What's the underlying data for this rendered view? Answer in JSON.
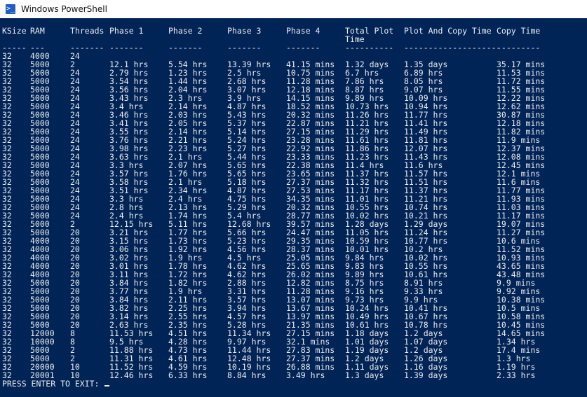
{
  "window": {
    "title": "Windows PowerShell",
    "icon": "powershell-icon"
  },
  "table": {
    "headers": [
      "KSize",
      "RAM",
      "Threads",
      "Phase 1",
      "Phase 2",
      "Phase 3",
      "Phase 4",
      "Total Plot",
      "Plot And Copy Time",
      "Copy Time"
    ],
    "header_line2": "Time",
    "separators": [
      "-----",
      "---",
      "-------",
      "-------",
      "-------",
      "-------",
      "-------",
      "----------",
      "--------------------",
      "---------"
    ],
    "rows": [
      [
        "32",
        "4000",
        "24",
        "",
        "",
        "",
        "",
        "",
        "",
        ""
      ],
      [
        "32",
        "5000",
        "2",
        "12.1 hrs",
        "5.54 hrs",
        "13.39 hrs",
        "41.15 mins",
        "1.32 days",
        "1.35 days",
        "35.17 mins"
      ],
      [
        "32",
        "5000",
        "24",
        "2.79 hrs",
        "1.23 hrs",
        "2.5 hrs",
        "10.75 mins",
        "6.7 hrs",
        "6.89 hrs",
        "11.53 mins"
      ],
      [
        "32",
        "5000",
        "24",
        "3.54 hrs",
        "1.44 hrs",
        "2.68 hrs",
        "11.28 mins",
        "7.86 hrs",
        "8.05 hrs",
        "11.72 mins"
      ],
      [
        "32",
        "5000",
        "24",
        "3.56 hrs",
        "2.04 hrs",
        "3.07 hrs",
        "12.18 mins",
        "8.87 hrs",
        "9.07 hrs",
        "11.55 mins"
      ],
      [
        "32",
        "5000",
        "24",
        "3.43 hrs",
        "2.3 hrs",
        "3.9 hrs",
        "14.15 mins",
        "9.89 hrs",
        "10.09 hrs",
        "12.22 mins"
      ],
      [
        "32",
        "5000",
        "24",
        "3.4 hrs",
        "2.14 hrs",
        "4.87 hrs",
        "18.52 mins",
        "10.73 hrs",
        "10.94 hrs",
        "12.62 mins"
      ],
      [
        "32",
        "5000",
        "24",
        "3.46 hrs",
        "2.03 hrs",
        "5.43 hrs",
        "20.32 mins",
        "11.26 hrs",
        "11.77 hrs",
        "30.87 mins"
      ],
      [
        "32",
        "5000",
        "24",
        "3.41 hrs",
        "2.05 hrs",
        "5.37 hrs",
        "22.87 mins",
        "11.21 hrs",
        "11.41 hrs",
        "12.18 mins"
      ],
      [
        "32",
        "5000",
        "24",
        "3.55 hrs",
        "2.14 hrs",
        "5.14 hrs",
        "27.15 mins",
        "11.29 hrs",
        "11.49 hrs",
        "11.82 mins"
      ],
      [
        "32",
        "5000",
        "24",
        "3.76 hrs",
        "2.21 hrs",
        "5.24 hrs",
        "23.28 mins",
        "11.61 hrs",
        "11.81 hrs",
        "11.9 mins"
      ],
      [
        "32",
        "5000",
        "24",
        "3.98 hrs",
        "2.23 hrs",
        "5.27 hrs",
        "22.92 mins",
        "11.86 hrs",
        "12.07 hrs",
        "12.37 mins"
      ],
      [
        "32",
        "5000",
        "24",
        "3.63 hrs",
        "2.1 hrs",
        "5.44 hrs",
        "23.33 mins",
        "11.23 hrs",
        "11.43 hrs",
        "12.08 mins"
      ],
      [
        "32",
        "5000",
        "24",
        "3.3 hrs",
        "2.07 hrs",
        "5.65 hrs",
        "22.38 mins",
        "11.4 hrs",
        "11.6 hrs",
        "12.45 mins"
      ],
      [
        "32",
        "5000",
        "24",
        "3.57 hrs",
        "1.76 hrs",
        "5.65 hrs",
        "23.65 mins",
        "11.37 hrs",
        "11.57 hrs",
        "12.1 mins"
      ],
      [
        "32",
        "5000",
        "24",
        "3.58 hrs",
        "2.1 hrs",
        "5.18 hrs",
        "27.37 mins",
        "11.32 hrs",
        "11.51 hrs",
        "11.6 mins"
      ],
      [
        "32",
        "5000",
        "24",
        "3.51 hrs",
        "2.34 hrs",
        "4.87 hrs",
        "27.53 mins",
        "11.17 hrs",
        "11.37 hrs",
        "11.77 mins"
      ],
      [
        "32",
        "5000",
        "24",
        "3.3 hrs",
        "2.4 hrs",
        "4.75 hrs",
        "34.35 mins",
        "11.01 hrs",
        "11.21 hrs",
        "11.93 mins"
      ],
      [
        "32",
        "5000",
        "24",
        "2.8 hrs",
        "2.13 hrs",
        "5.29 hrs",
        "20.32 mins",
        "10.55 hrs",
        "10.74 hrs",
        "11.03 mins"
      ],
      [
        "32",
        "5000",
        "24",
        "2.4 hrs",
        "1.74 hrs",
        "5.4 hrs",
        "28.77 mins",
        "10.02 hrs",
        "10.21 hrs",
        "11.17 mins"
      ],
      [
        "32",
        "5000",
        "2",
        "12.15 hrs",
        "5.11 hrs",
        "12.68 hrs",
        "39.57 mins",
        "1.28 days",
        "1.29 days",
        "19.07 mins"
      ],
      [
        "32",
        "5000",
        "20",
        "3.21 hrs",
        "1.77 hrs",
        "5.66 hrs",
        "24.47 mins",
        "11.05 hrs",
        "11.24 hrs",
        "11.27 mins"
      ],
      [
        "32",
        "4000",
        "20",
        "3.15 hrs",
        "1.73 hrs",
        "5.23 hrs",
        "29.35 mins",
        "10.59 hrs",
        "10.77 hrs",
        "10.6 mins"
      ],
      [
        "32",
        "4000",
        "20",
        "3.06 hrs",
        "1.92 hrs",
        "4.56 hrs",
        "28.37 mins",
        "10.01 hrs",
        "10.2 hrs",
        "11.52 mins"
      ],
      [
        "32",
        "4000",
        "20",
        "3.02 hrs",
        "1.9 hrs",
        "4.5 hrs",
        "25.05 mins",
        "9.84 hrs",
        "10.02 hrs",
        "10.93 mins"
      ],
      [
        "32",
        "4000",
        "20",
        "3.01 hrs",
        "1.78 hrs",
        "4.62 hrs",
        "25.65 mins",
        "9.83 hrs",
        "10.55 hrs",
        "43.65 mins"
      ],
      [
        "32",
        "4000",
        "20",
        "3.11 hrs",
        "1.72 hrs",
        "4.62 hrs",
        "26.02 mins",
        "9.89 hrs",
        "10.61 hrs",
        "43.48 mins"
      ],
      [
        "32",
        "5000",
        "20",
        "3.84 hrs",
        "1.82 hrs",
        "2.88 hrs",
        "12.82 mins",
        "8.75 hrs",
        "8.91 hrs",
        "9.9 mins"
      ],
      [
        "32",
        "5000",
        "20",
        "3.77 hrs",
        "1.9 hrs",
        "3.31 hrs",
        "11.28 mins",
        "9.16 hrs",
        "9.33 hrs",
        "9.92 mins"
      ],
      [
        "32",
        "5000",
        "20",
        "3.84 hrs",
        "2.11 hrs",
        "3.57 hrs",
        "13.07 mins",
        "9.73 hrs",
        "9.9 hrs",
        "10.38 mins"
      ],
      [
        "32",
        "5000",
        "20",
        "3.82 hrs",
        "2.25 hrs",
        "3.94 hrs",
        "13.67 mins",
        "10.24 hrs",
        "10.41 hrs",
        "10.5 mins"
      ],
      [
        "32",
        "5000",
        "20",
        "3.14 hrs",
        "2.55 hrs",
        "4.57 hrs",
        "13.97 mins",
        "10.49 hrs",
        "10.67 hrs",
        "10.58 mins"
      ],
      [
        "32",
        "5000",
        "20",
        "2.63 hrs",
        "2.35 hrs",
        "5.28 hrs",
        "21.35 mins",
        "10.61 hrs",
        "10.78 hrs",
        "10.45 mins"
      ],
      [
        "32",
        "12000",
        "8",
        "11.53 hrs",
        "4.51 hrs",
        "11.34 hrs",
        "27.15 mins",
        "1.18 days",
        "1.2 days",
        "14.65 mins"
      ],
      [
        "32",
        "10000",
        "8",
        "9.5 hrs",
        "4.28 hrs",
        "9.97 hrs",
        "32.1 mins",
        "1.01 days",
        "1.07 days",
        "1.34 hrs"
      ],
      [
        "32",
        "5000",
        "2",
        "11.88 hrs",
        "4.73 hrs",
        "11.44 hrs",
        "27.83 mins",
        "1.19 days",
        "1.2 days",
        "17.4 mins"
      ],
      [
        "32",
        "5000",
        "2",
        "11.31 hrs",
        "4.61 hrs",
        "12.48 hrs",
        "27.37 mins",
        "1.2 days",
        "1.26 days",
        "1.3 hrs"
      ],
      [
        "32",
        "20000",
        "10",
        "11.52 hrs",
        "4.59 hrs",
        "10.19 hrs",
        "26.88 mins",
        "1.11 days",
        "1.16 days",
        "1.19 hrs"
      ],
      [
        "32",
        "20001",
        "10",
        "12.46 hrs",
        "6.33 hrs",
        "8.84 hrs",
        "3.49 hrs",
        "1.3 days",
        "1.39 days",
        "2.33 hrs"
      ]
    ]
  },
  "prompt": "PRESS ENTER TO EXIT: "
}
